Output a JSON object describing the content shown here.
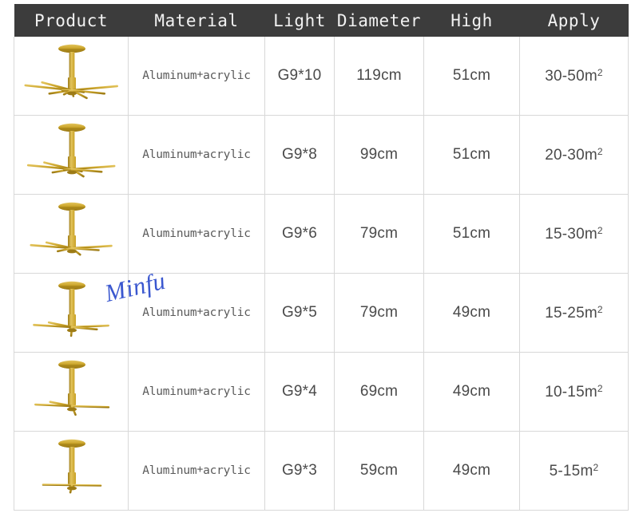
{
  "table": {
    "headers": [
      {
        "key": "product",
        "label": "Product"
      },
      {
        "key": "material",
        "label": "Material"
      },
      {
        "key": "light",
        "label": "Light"
      },
      {
        "key": "diameter",
        "label": "Diameter"
      },
      {
        "key": "high",
        "label": "High"
      },
      {
        "key": "apply",
        "label": "Apply"
      }
    ],
    "header_bg": "#3c3c3c",
    "header_text_color": "#f2f2f2",
    "grid_color": "#d8d8d8",
    "rows": [
      {
        "product_icon": "chandelier-10-light",
        "lamp_count": 10,
        "material": "Aluminum+acrylic",
        "light": "G9*10",
        "diameter": "119cm",
        "high": "51cm",
        "apply": "30-50m²"
      },
      {
        "product_icon": "chandelier-8-light",
        "lamp_count": 8,
        "material": "Aluminum+acrylic",
        "light": "G9*8",
        "diameter": "99cm",
        "high": "51cm",
        "apply": "20-30m²"
      },
      {
        "product_icon": "chandelier-6-light",
        "lamp_count": 6,
        "material": "Aluminum+acrylic",
        "light": "G9*6",
        "diameter": "79cm",
        "high": "51cm",
        "apply": "15-30m²"
      },
      {
        "product_icon": "chandelier-5-light",
        "lamp_count": 5,
        "material": "Aluminum+acrylic",
        "light": "G9*5",
        "diameter": "79cm",
        "high": "49cm",
        "apply": "15-25m²"
      },
      {
        "product_icon": "chandelier-4-light",
        "lamp_count": 4,
        "material": "Aluminum+acrylic",
        "light": "G9*4",
        "diameter": "69cm",
        "high": "49cm",
        "apply": "10-15m²"
      },
      {
        "product_icon": "chandelier-3-light",
        "lamp_count": 3,
        "material": "Aluminum+acrylic",
        "light": "G9*3",
        "diameter": "59cm",
        "high": "49cm",
        "apply": "5-15m²"
      }
    ]
  },
  "watermark": {
    "text": "Minfu",
    "color": "#3a57cf"
  },
  "colors": {
    "gold": "#c9a227",
    "gold_light": "#e3c45c",
    "gold_dark": "#9d7b16",
    "shade_black": "#2a2724",
    "shade_glow": "#fdf6e0"
  }
}
